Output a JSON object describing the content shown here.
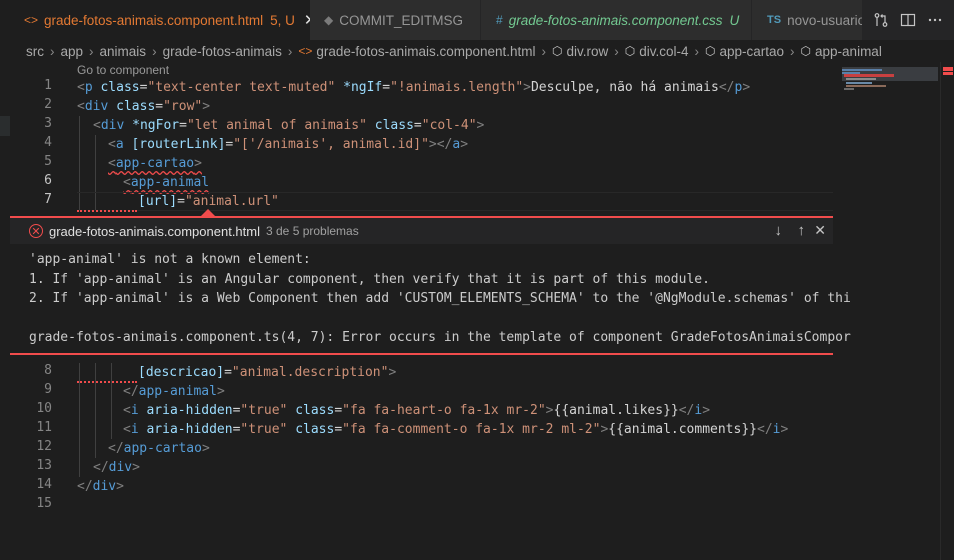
{
  "tabs": [
    {
      "icon": "<>",
      "label": "grade-fotos-animais.component.html",
      "status": "5, U",
      "close": "✕"
    },
    {
      "icon": "◆",
      "label": "COMMIT_EDITMSG"
    },
    {
      "icon": "#",
      "label": "grade-fotos-animais.component.css",
      "status": "U"
    },
    {
      "icon": "TS",
      "label": "novo-usuario"
    }
  ],
  "breadcrumb": [
    "src",
    "app",
    "animais",
    "grade-fotos-animais",
    "grade-fotos-animais.component.html",
    "div.row",
    "div.col-4",
    "app-cartao",
    "app-animal"
  ],
  "codelens": "Go to component",
  "line_numbers": [
    "1",
    "2",
    "3",
    "4",
    "5",
    "6",
    "7",
    "8",
    "9",
    "10",
    "11",
    "12",
    "13",
    "14",
    "15"
  ],
  "peek": {
    "file": "grade-fotos-animais.component.html",
    "count": "3 de 5 problemas",
    "lines": [
      "'app-animal' is not a known element:",
      "1. If 'app-animal' is an Angular component, then verify that it is part of this module.",
      "2. If 'app-animal' is a Web Component then add 'CUSTOM_ELEMENTS_SCHEMA' to the '@NgModule.schemas' of thi",
      "",
      "grade-fotos-animais.component.ts(4, 7): Error occurs in the template of component GradeFotosAnimaisCompor"
    ]
  },
  "code": {
    "l1": {
      "a": "<",
      "b": "p",
      "c": " class",
      "d": "=",
      "e": "\"text-center text-muted\"",
      "f": " *ngIf",
      "g": "=",
      "h": "\"!animais.length\"",
      "i": ">",
      "j": "Desculpe, não há animais",
      "k": "</",
      "l": "p",
      "m": ">"
    },
    "l2": {
      "a": "<",
      "b": "div",
      "c": " class",
      "d": "=",
      "e": "\"row\"",
      "f": ">"
    },
    "l3": {
      "a": "<",
      "b": "div",
      "c": " *ngFor",
      "d": "=",
      "e": "\"let animal of animais\"",
      "f": " class",
      "g": "=",
      "h": "\"col-4\"",
      "i": ">"
    },
    "l4": {
      "a": "<",
      "b": "a",
      "c": " [routerLink]",
      "d": "=",
      "e": "\"['/animais', animal.id]\"",
      "f": "></",
      "g": "a",
      "h": ">"
    },
    "l5": {
      "a": "<",
      "b": "app-cartao",
      "c": ">"
    },
    "l6": {
      "a": "<",
      "b": "app-animal"
    },
    "l7": {
      "a": "[url]",
      "b": "=",
      "c": "\"animal.url\""
    },
    "l8": {
      "a": "[descricao]",
      "b": "=",
      "c": "\"animal.description\"",
      "d": ">"
    },
    "l9": {
      "a": "</",
      "b": "app-animal",
      "c": ">"
    },
    "l10": {
      "a": "<",
      "b": "i",
      "c": " aria-hidden",
      "d": "=",
      "e": "\"true\"",
      "f": " class",
      "g": "=",
      "h": "\"fa fa-heart-o fa-1x mr-2\"",
      "i": ">",
      "j": "{{animal.likes}}",
      "k": "</",
      "l": "i",
      "m": ">"
    },
    "l11": {
      "a": "<",
      "b": "i",
      "c": " aria-hidden",
      "d": "=",
      "e": "\"true\"",
      "f": " class",
      "g": "=",
      "h": "\"fa fa-comment-o fa-1x mr-2 ml-2\"",
      "i": ">",
      "j": "{{animal.comments}}",
      "k": "</",
      "l": "i",
      "m": ">"
    },
    "l12": {
      "a": "</",
      "b": "app-cartao",
      "c": ">"
    },
    "l13": {
      "a": "</",
      "b": "div",
      "c": ">"
    },
    "l14": {
      "a": "</",
      "b": "div",
      "c": ">"
    }
  },
  "colors": {
    "error": "#f14c4c",
    "tag": "#569cd6",
    "attr": "#9cdcfe",
    "string": "#ce9178",
    "modified_tab": "#e37933"
  }
}
